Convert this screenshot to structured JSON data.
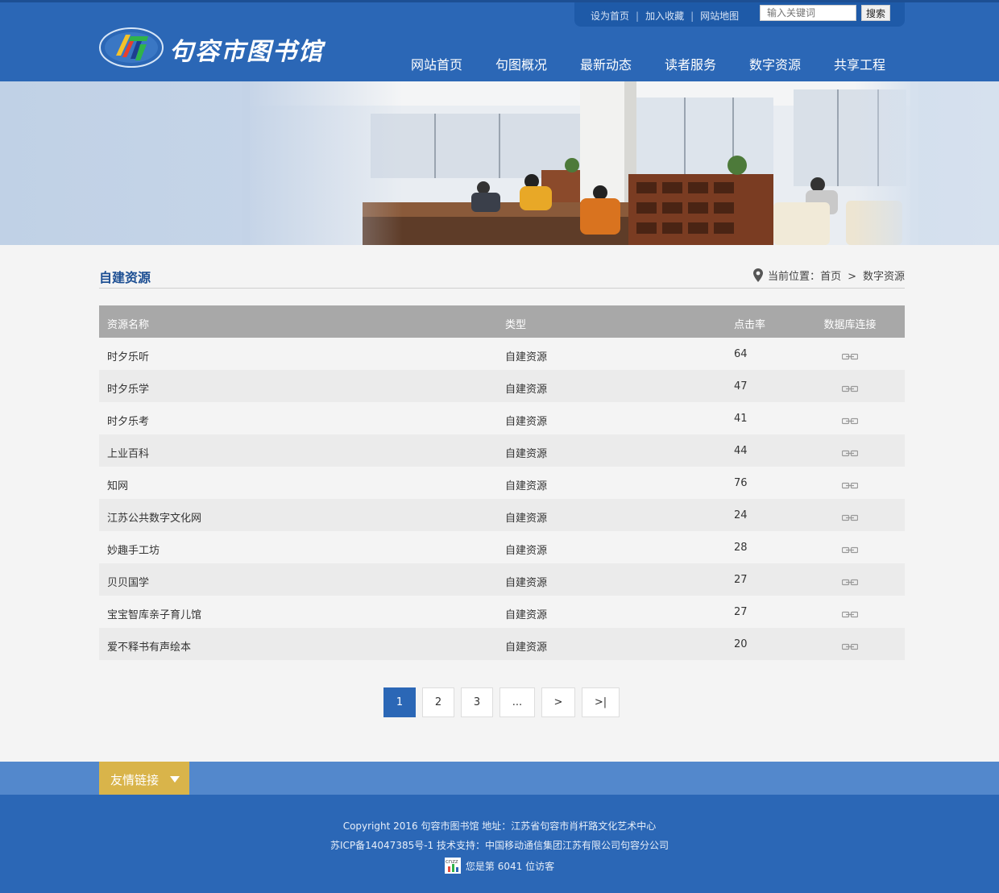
{
  "top": {
    "set_home": "设为首页",
    "add_fav": "加入收藏",
    "sitemap": "网站地图",
    "search_placeholder": "输入关键词",
    "search_button": "搜索"
  },
  "logo": {
    "text": "句容市图书馆"
  },
  "nav": [
    "网站首页",
    "句图概况",
    "最新动态",
    "读者服务",
    "数字资源",
    "共享工程"
  ],
  "section": {
    "title": "自建资源",
    "breadcrumb_prefix": "当前位置：",
    "crumb_home": "首页",
    "crumb_sep": ">",
    "crumb_current": "数字资源"
  },
  "table": {
    "headers": [
      "资源名称",
      "类型",
      "点击率",
      "数据库连接"
    ],
    "rows": [
      {
        "name": "时夕乐听",
        "type": "自建资源",
        "clicks": "64"
      },
      {
        "name": "时夕乐学",
        "type": "自建资源",
        "clicks": "47"
      },
      {
        "name": "时夕乐考",
        "type": "自建资源",
        "clicks": "41"
      },
      {
        "name": "上业百科",
        "type": "自建资源",
        "clicks": "44"
      },
      {
        "name": "知网",
        "type": "自建资源",
        "clicks": "76"
      },
      {
        "name": "江苏公共数字文化网",
        "type": "自建资源",
        "clicks": "24"
      },
      {
        "name": "妙趣手工坊",
        "type": "自建资源",
        "clicks": "28"
      },
      {
        "name": "贝贝国学",
        "type": "自建资源",
        "clicks": "27"
      },
      {
        "name": "宝宝智库亲子育儿馆",
        "type": "自建资源",
        "clicks": "27"
      },
      {
        "name": "爱不释书有声绘本",
        "type": "自建资源",
        "clicks": "20"
      }
    ]
  },
  "pagination": [
    "1",
    "2",
    "3",
    "...",
    ">",
    ">|"
  ],
  "footer": {
    "friend_links": "友情链接",
    "line1": "Copyright 2016 句容市图书馆 地址：江苏省句容市肖杆路文化艺术中心",
    "line2": "苏ICP备14047385号-1 技术支持：中国移动通信集团江苏有限公司句容分公司",
    "line3": "您是第 6041 位访客",
    "counter_badge": "cnzz"
  },
  "colors": {
    "brand_blue": "#2b67b6",
    "table_header": "#a8a8a8",
    "friend_tab": "#d9b44a"
  }
}
